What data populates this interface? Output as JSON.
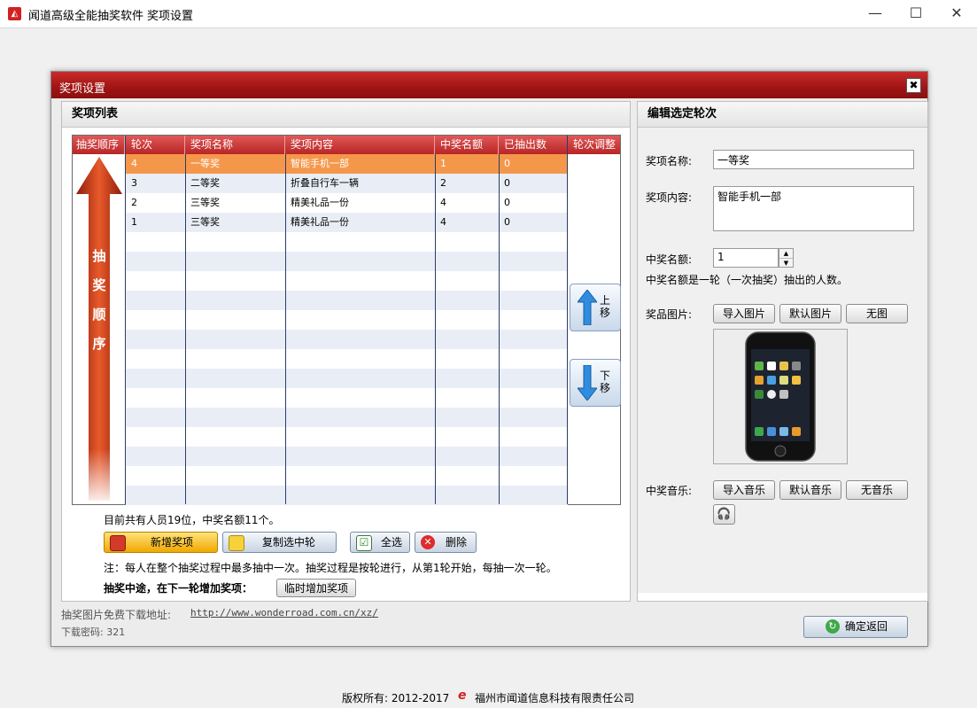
{
  "window": {
    "app_title": "闻道高级全能抽奖软件",
    "section_title": "奖项设置",
    "minimize_glyph": "—",
    "maximize_glyph": "☐",
    "close_glyph": "✕"
  },
  "dialog": {
    "title": "奖项设置",
    "close_glyph": "✖"
  },
  "left_panel": {
    "title": "奖项列表",
    "side_header": "抽奖顺序",
    "side_arrow_text": [
      "抽",
      "奖",
      "顺",
      "序"
    ],
    "right_header": "轮次调整",
    "up_label": "上\n移",
    "down_label": "下\n移",
    "columns": [
      "轮次",
      "奖项名称",
      "奖项内容",
      "中奖名额",
      "已抽出数"
    ],
    "rows": [
      [
        "4",
        "一等奖",
        "智能手机一部",
        "1",
        "0"
      ],
      [
        "3",
        "二等奖",
        "折叠自行车一辆",
        "2",
        "0"
      ],
      [
        "2",
        "三等奖",
        "精美礼品一份",
        "4",
        "0"
      ],
      [
        "1",
        "三等奖",
        "精美礼品一份",
        "4",
        "0"
      ]
    ],
    "selected_row": 0,
    "summary": "目前共有人员19位，中奖名额11个。",
    "buttons": {
      "add": "新增奖项",
      "copy": "复制选中轮",
      "select_all": "全选",
      "delete": "删除"
    },
    "note": "注：每人在整个抽奖过程中最多抽中一次。抽奖过程是按轮进行，从第1轮开始，每抽一次一轮。",
    "mid_add_label": "抽奖中途，在下一轮增加奖项：",
    "mid_add_button": "临时增加奖项"
  },
  "right_panel": {
    "title": "编辑选定轮次",
    "name_label": "奖项名称:",
    "name_value": "一等奖",
    "content_label": "奖项内容:",
    "content_value": "智能手机一部",
    "quota_label": "中奖名额:",
    "quota_value": "1",
    "quota_hint": "中奖名额是一轮（一次抽奖）抽出的人数。",
    "image_label": "奖品图片:",
    "image_buttons": [
      "导入图片",
      "默认图片",
      "无图"
    ],
    "music_label": "中奖音乐:",
    "music_buttons": [
      "导入音乐",
      "默认音乐",
      "无音乐"
    ]
  },
  "footer": {
    "download_label": "抽奖图片免费下载地址:",
    "download_url": "http://www.wonderroad.com.cn/xz/",
    "password_label": "下载密码: 321",
    "confirm_button": "确定返回"
  },
  "copyright": {
    "text": "版权所有: 2012-2017",
    "company": "福州市闻道信息科技有限责任公司"
  },
  "colors": {
    "header_red": "#b82525",
    "selected_row": "#f5974b",
    "alt_row": "#e9eef6"
  }
}
